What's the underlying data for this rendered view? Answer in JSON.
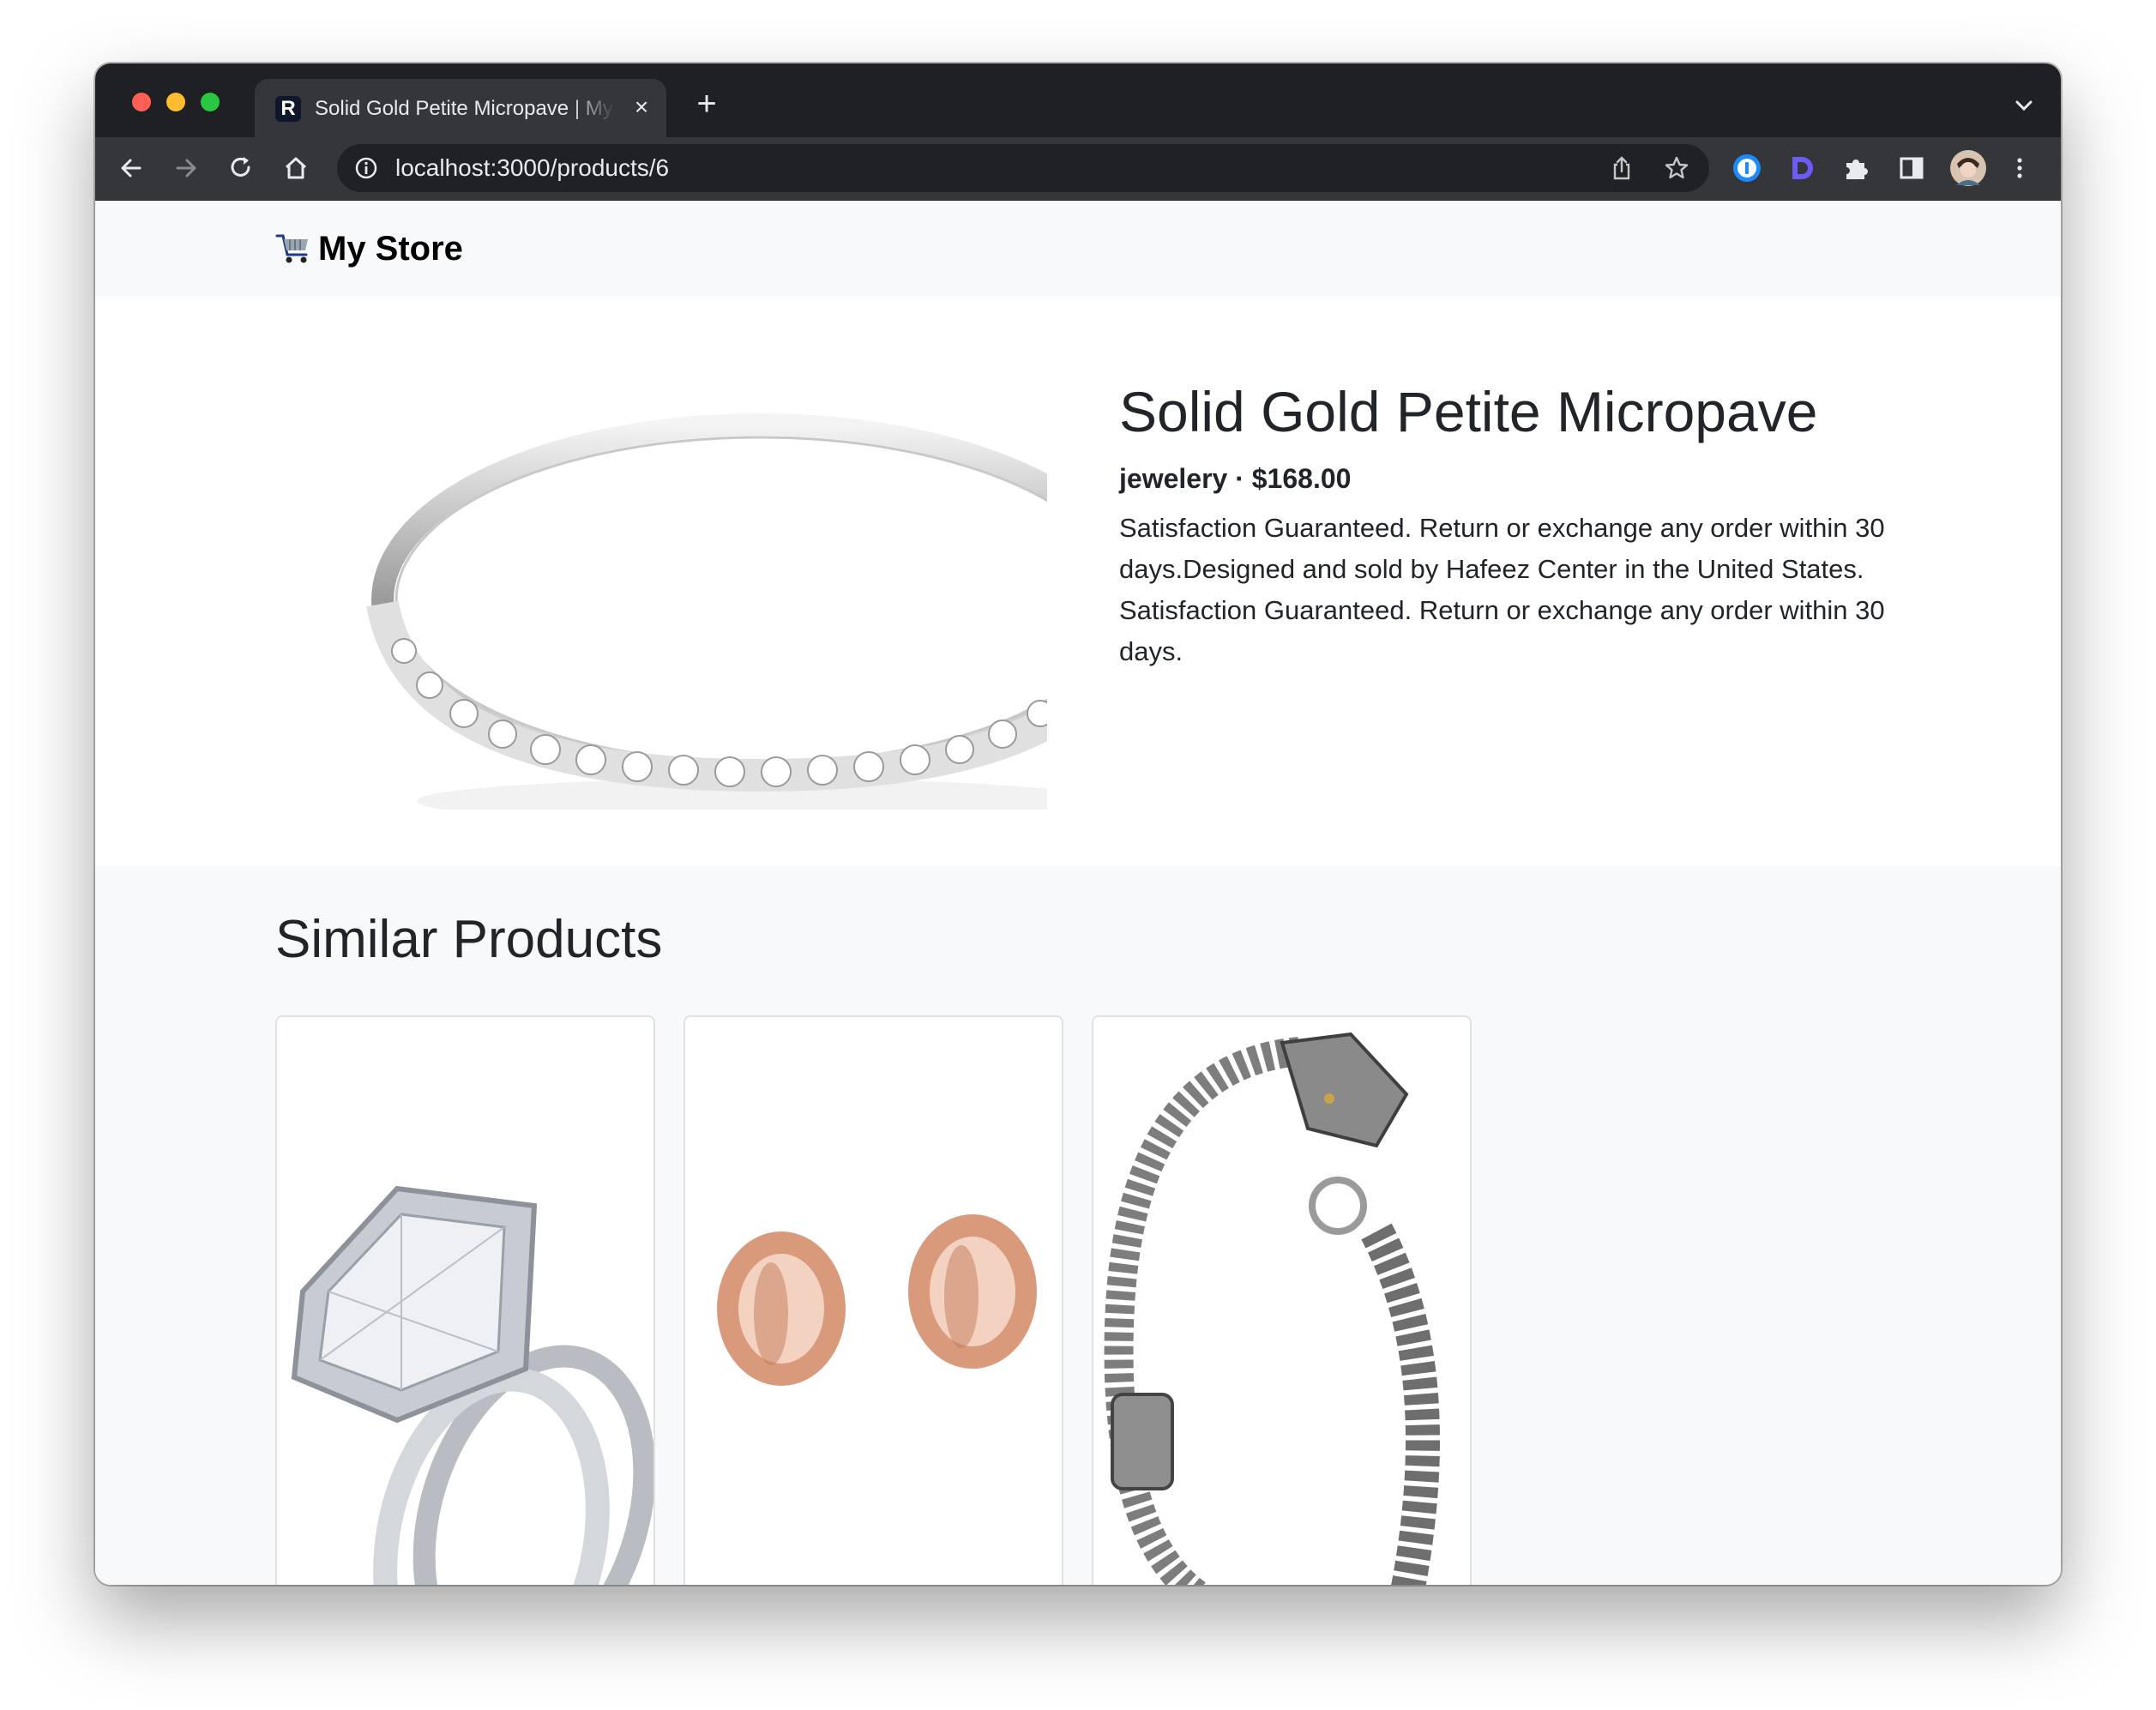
{
  "browser": {
    "tab": {
      "title": "Solid Gold Petite Micropave | My Store",
      "favicon_letter": "R"
    },
    "url": "localhost:3000/products/6",
    "icons": [
      "back-icon",
      "forward-icon",
      "reload-icon",
      "home-icon",
      "info-icon",
      "share-icon",
      "star-icon",
      "onepassword-icon",
      "extension-d-icon",
      "puzzle-icon",
      "sidepanel-icon",
      "profile-avatar",
      "menu-kebab-icon"
    ]
  },
  "store": {
    "brand_name": "My Store",
    "brand_icon": "shopping-cart-icon"
  },
  "product": {
    "title": "Solid Gold Petite Micropave",
    "meta": "jewelery · $168.00",
    "description": "Satisfaction Guaranteed. Return or exchange any order within 30 days.Designed and sold by Hafeez Center in the United States. Satisfaction Guaranteed. Return or exchange any order within 30 days.",
    "image": "silver-band-ring-image"
  },
  "similar": {
    "heading": "Similar Products",
    "items": [
      {
        "image": "halo-engagement-ring-image"
      },
      {
        "image": "rose-gold-tunnel-plugs-image"
      },
      {
        "image": "dragon-chain-bracelet-image"
      }
    ]
  },
  "colors": {
    "chrome_dark": "#1f2023",
    "toolbar": "#35363a",
    "nav_bg": "#f8f9fa",
    "text": "#212529"
  }
}
